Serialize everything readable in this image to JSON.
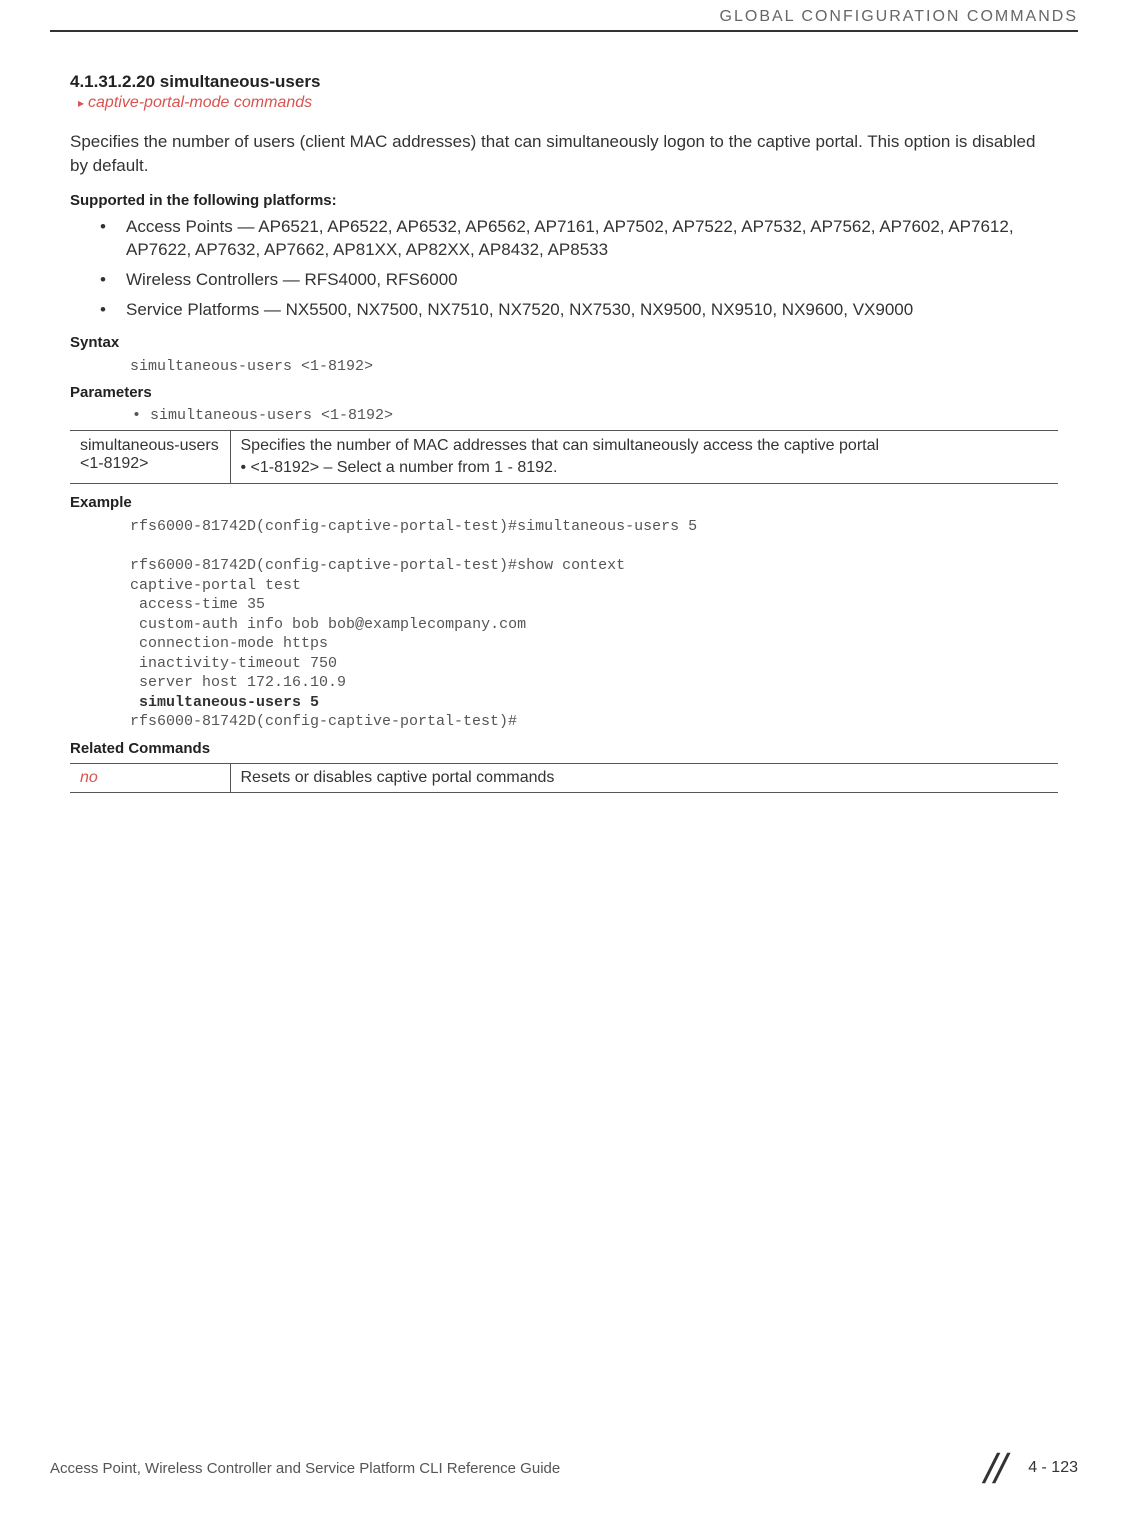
{
  "header": {
    "running_title": "GLOBAL CONFIGURATION COMMANDS"
  },
  "section": {
    "number_title": "4.1.31.2.20 simultaneous-users",
    "breadcrumb_link": "captive-portal-mode commands",
    "description": "Specifies the number of users (client MAC addresses) that can simultaneously logon to the captive portal. This option is disabled by default.",
    "supported_heading": "Supported in the following platforms:",
    "supported": [
      "Access Points — AP6521, AP6522, AP6532, AP6562, AP7161, AP7502, AP7522, AP7532, AP7562, AP7602, AP7612, AP7622, AP7632, AP7662, AP81XX, AP82XX, AP8432, AP8533",
      "Wireless Controllers — RFS4000, RFS6000",
      "Service Platforms — NX5500, NX7500, NX7510, NX7520, NX7530, NX9500, NX9510, NX9600, VX9000"
    ],
    "syntax_heading": "Syntax",
    "syntax_line": "simultaneous-users <1-8192>",
    "parameters_heading": "Parameters",
    "parameters_bullet": "simultaneous-users <1-8192>",
    "param_table": {
      "key": "simultaneous-users <1-8192>",
      "desc": "Specifies the number of MAC addresses that can simultaneously access the captive portal",
      "sub": "<1-8192> – Select a number from 1 - 8192."
    },
    "example_heading": "Example",
    "example_lines": "rfs6000-81742D(config-captive-portal-test)#simultaneous-users 5\n\nrfs6000-81742D(config-captive-portal-test)#show context\ncaptive-portal test\n access-time 35\n custom-auth info bob bob@examplecompany.com\n connection-mode https\n inactivity-timeout 750\n server host 172.16.10.9",
    "example_bold_line": " simultaneous-users 5",
    "example_tail": "rfs6000-81742D(config-captive-portal-test)#",
    "related_heading": "Related Commands",
    "related_table": {
      "key": "no",
      "desc": "Resets or disables captive portal commands"
    }
  },
  "footer": {
    "title": "Access Point, Wireless Controller and Service Platform CLI Reference Guide",
    "page": "4 - 123"
  }
}
